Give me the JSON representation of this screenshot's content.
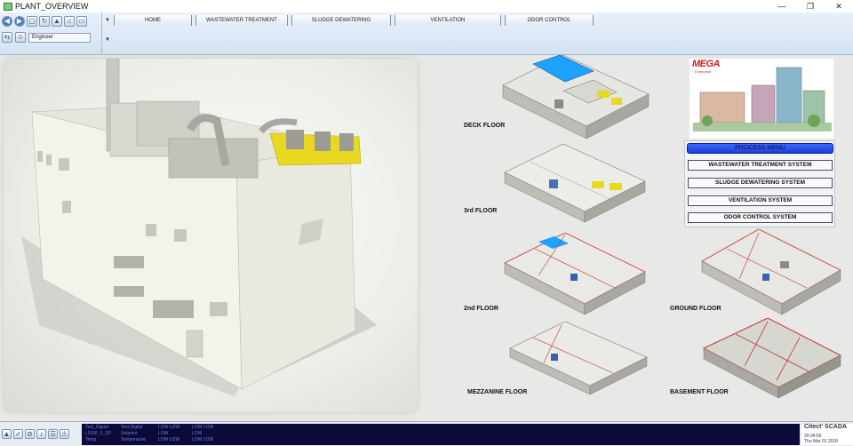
{
  "window": {
    "title": "PLANT_OVERVIEW",
    "controls": {
      "minimize": "—",
      "restore": "❐",
      "close": "✕"
    }
  },
  "toolbar": {
    "user": "Engineer",
    "tab_caret": "▼",
    "tabs": [
      {
        "label": "HOME"
      },
      {
        "label": "WASTEWATER TREATMENT"
      },
      {
        "label": "SLUDGE DEWATERING"
      },
      {
        "label": "VENTILATION"
      },
      {
        "label": "ODOR CONTROL"
      }
    ]
  },
  "floors": [
    {
      "label": "DECK FLOOR"
    },
    {
      "label": "3rd FLOOR"
    },
    {
      "label": "2nd FLOOR"
    },
    {
      "label": "GROUND FLOOR"
    },
    {
      "label": "MEZZANINE FLOOR"
    },
    {
      "label": "BASEMENT FLOOR"
    }
  ],
  "logo": {
    "text": "MEGA",
    "sub": "Enterprise"
  },
  "process_menu": {
    "header": "PROCESS MENU",
    "items": [
      {
        "label": "WASTEWATER TREATMENT SYSTEM"
      },
      {
        "label": "SLUDGE DEWATERING SYSTEM"
      },
      {
        "label": "VENTILATION   SYSTEM"
      },
      {
        "label": "ODOR CONTROL SYSTEM"
      }
    ]
  },
  "alarms": [
    {
      "tag": "Test_Digital",
      "desc": "Test Digital",
      "c1": "LOW LOW",
      "c2": "LOW LOW"
    },
    {
      "tag": "LOOP_3_SP",
      "desc": "Setpoint",
      "c1": "LOW",
      "c2": "LOW"
    },
    {
      "tag": "Temp",
      "desc": "Temperature",
      "c1": "LOW LOW",
      "c2": "LOW LOW"
    }
  ],
  "status": {
    "brand": "Citect' SCADA",
    "time": "20:34:56",
    "date": "Thu Mar 01 2018"
  },
  "colors": {
    "accent": "#1a3fd8",
    "toolbar": "#d3e2f2",
    "alarm_bg": "#0b0b3a",
    "building_equipment": "#e8d820",
    "logo_red": "#d12020"
  }
}
